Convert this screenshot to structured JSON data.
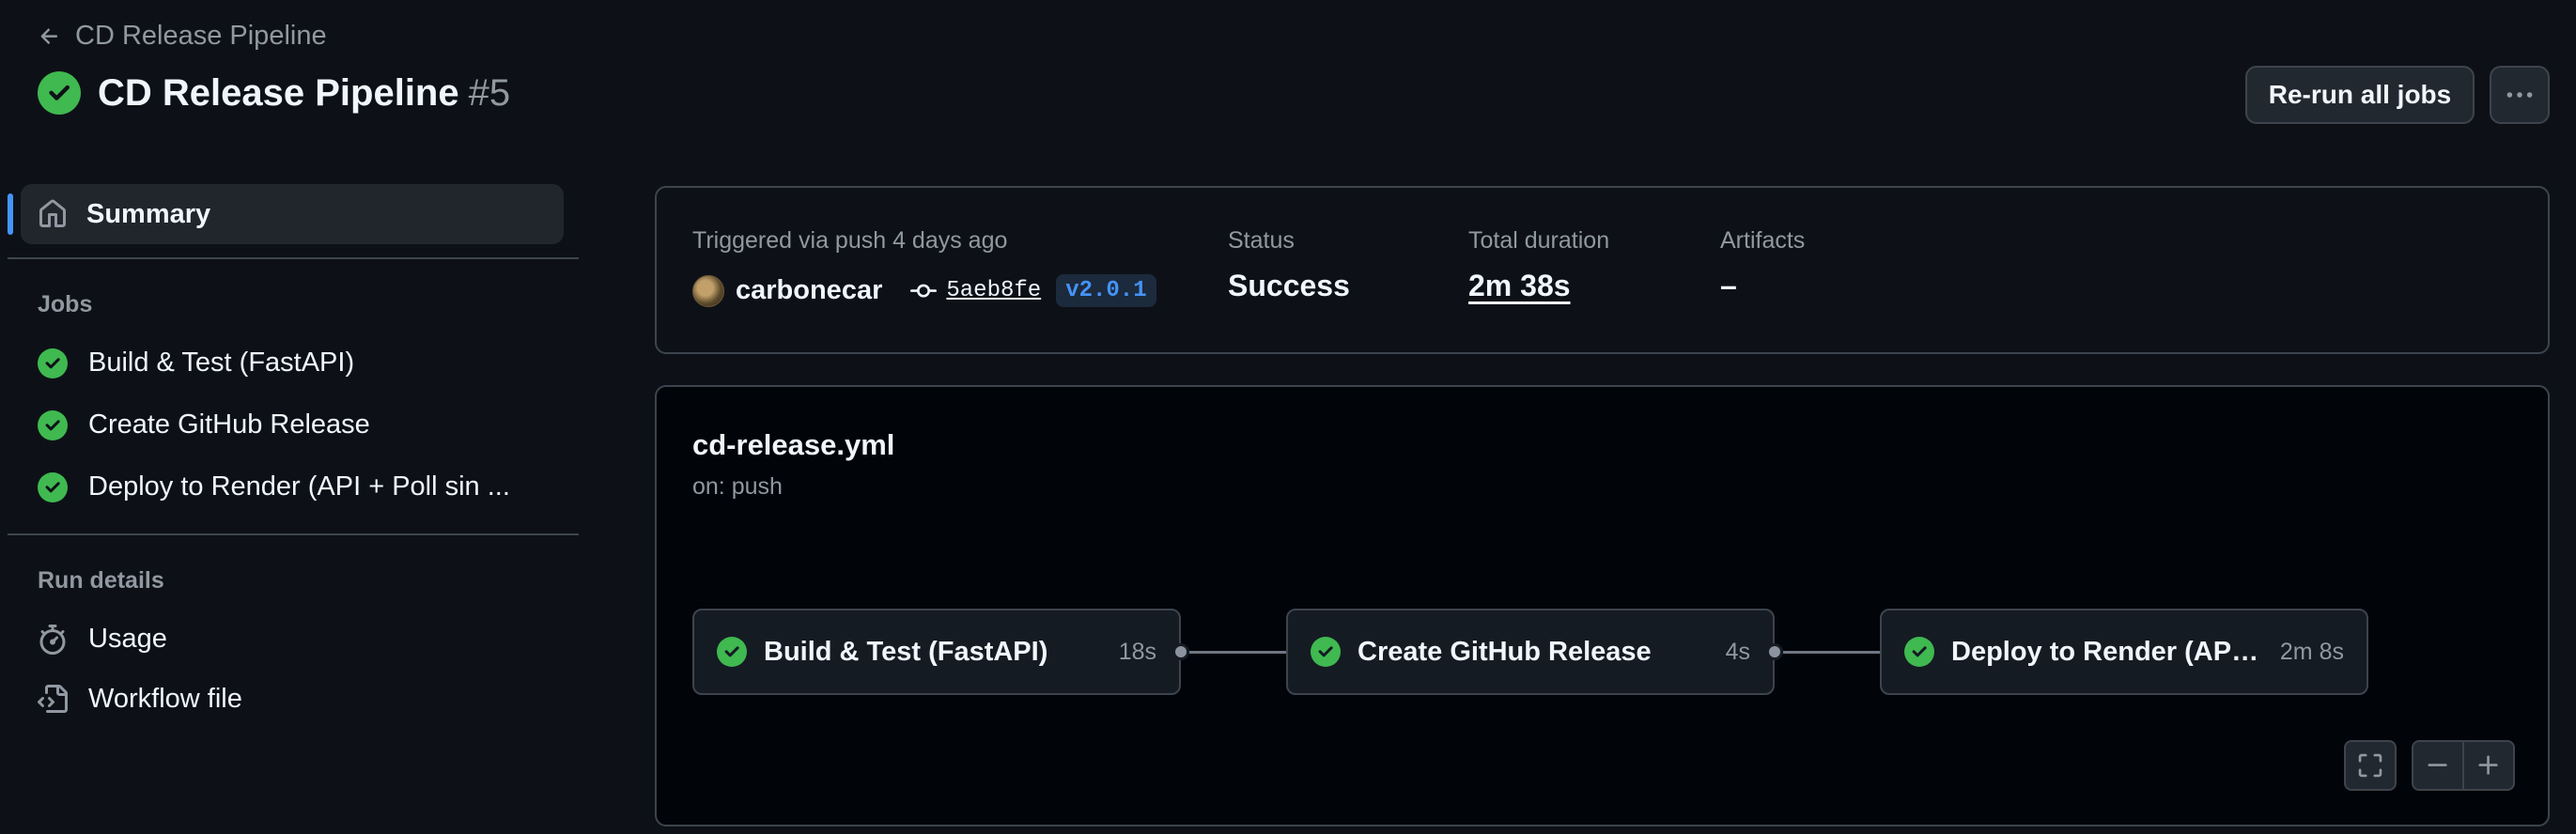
{
  "header": {
    "back_label": "CD Release Pipeline",
    "title": "CD Release Pipeline",
    "run_number": "#5",
    "rerun_label": "Re-run all jobs"
  },
  "sidebar": {
    "summary_label": "Summary",
    "jobs_heading": "Jobs",
    "jobs": [
      {
        "label": "Build & Test (FastAPI)"
      },
      {
        "label": "Create GitHub Release"
      },
      {
        "label": "Deploy to Render (API + Poll sin ..."
      }
    ],
    "run_details_heading": "Run details",
    "usage_label": "Usage",
    "workflow_file_label": "Workflow file"
  },
  "summary": {
    "trigger_text": "Triggered via push 4 days ago",
    "actor": "carbonecar",
    "commit_sha": "5aeb8fe",
    "tag": "v2.0.1",
    "status_label": "Status",
    "status_value": "Success",
    "duration_label": "Total duration",
    "duration_value": "2m 38s",
    "artifacts_label": "Artifacts",
    "artifacts_value": "–"
  },
  "workflow": {
    "file": "cd-release.yml",
    "trigger": "on: push",
    "nodes": [
      {
        "name": "Build & Test (FastAPI)",
        "time": "18s"
      },
      {
        "name": "Create GitHub Release",
        "time": "4s"
      },
      {
        "name": "Deploy to Render (API +...",
        "time": "2m 8s"
      }
    ]
  },
  "colors": {
    "success": "#3fb950",
    "accent": "#4493f8",
    "background": "#0d1117"
  },
  "icons": {
    "back": "arrow-left-icon",
    "status": "check-circle-icon",
    "more": "kebab-horizontal-icon",
    "summary": "home-icon",
    "usage": "stopwatch-icon",
    "workflow_file": "file-code-icon",
    "commit": "git-commit-icon",
    "fullscreen": "screen-full-icon",
    "zoom_out": "minus-icon",
    "zoom_in": "plus-icon"
  }
}
